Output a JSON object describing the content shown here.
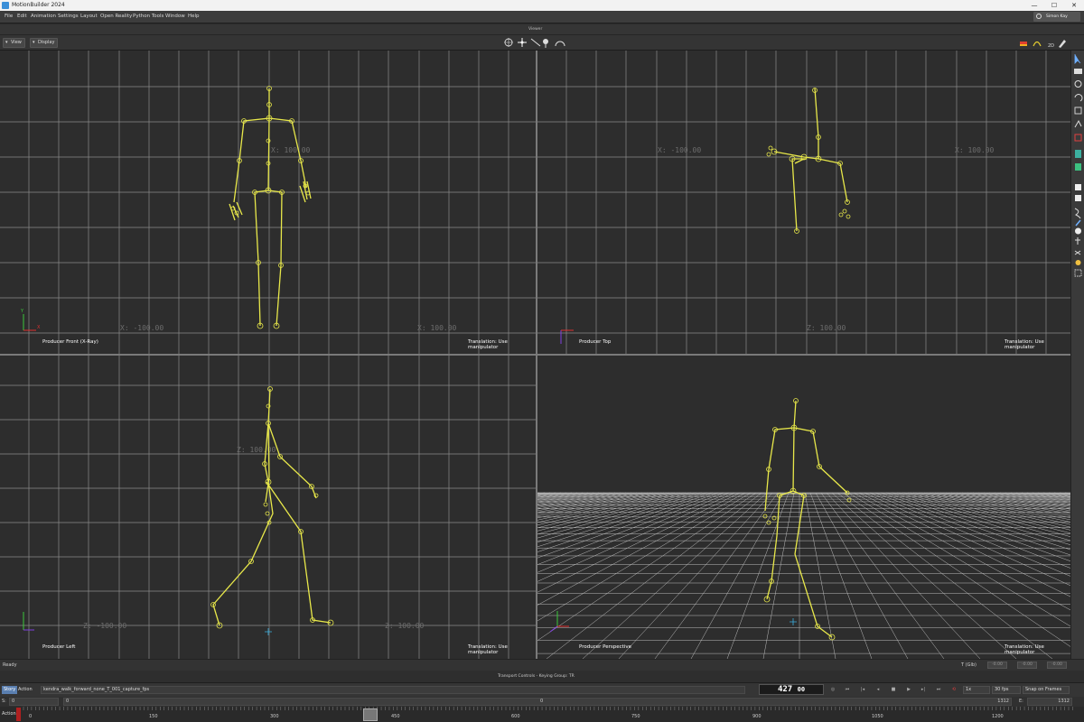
{
  "window": {
    "title": "MotionBuilder 2024",
    "minimize": "—",
    "maximize": "☐",
    "close": "✕"
  },
  "menu": [
    "File",
    "Edit",
    "Animation",
    "Settings",
    "Layout",
    "Open Reality",
    "Python Tools",
    "Window",
    "Help"
  ],
  "user": {
    "name": "Simon Kay"
  },
  "viewer": {
    "title": "Viewer",
    "view_btn": "View",
    "display_btn": "Display"
  },
  "panes": {
    "front": {
      "label": "Producer Front (X-Ray)",
      "status": "Translation: Use manipulator",
      "axis_left": "X: -100.00",
      "axis_right": "X: 100.00",
      "axis_mid": "X: 100.00"
    },
    "top": {
      "label": "Producer Top",
      "status": "Translation: Use manipulator",
      "axis_left": "X: -100.00",
      "axis_right": "X: 100.00",
      "axis_bottom": "Z: 100.00"
    },
    "left": {
      "label": "Producer Left",
      "status": "Translation: Use manipulator",
      "axis_mid": "Z: 100.00",
      "axis_bl": "Z: -100.00",
      "axis_br": "Z: 100.00"
    },
    "perspective": {
      "label": "Producer Perspective",
      "status": "Translation: Use manipulator"
    }
  },
  "status": {
    "ready": "Ready",
    "t_label": "T (Glb)",
    "t_x": "-0.00",
    "t_y": "-0.00",
    "t_z": "-0.00"
  },
  "transport": {
    "header": "Transport Controls  -  Keying Group: TR",
    "story": "Story",
    "action": "Action",
    "take": "kendra_walk_forward_none_T_001_capture_fps",
    "frame": "427",
    "frame_suffix": "00",
    "speed": "1x",
    "fps": "30 fps",
    "snap": "Snap on Frames"
  },
  "range": {
    "s_label": "S:",
    "start": "0",
    "mid_start": "0",
    "mid_end": "0",
    "end": "1312",
    "e_label": "E:",
    "end2": "1312"
  },
  "timeline": {
    "label": "Action",
    "ticks": [
      "0",
      "150",
      "300",
      "450",
      "600",
      "750",
      "900",
      "1050",
      "1200"
    ]
  },
  "colors": {
    "skeleton": "#e8e84a",
    "grid": "#8a8a8a",
    "bg": "#2d2d2d"
  }
}
